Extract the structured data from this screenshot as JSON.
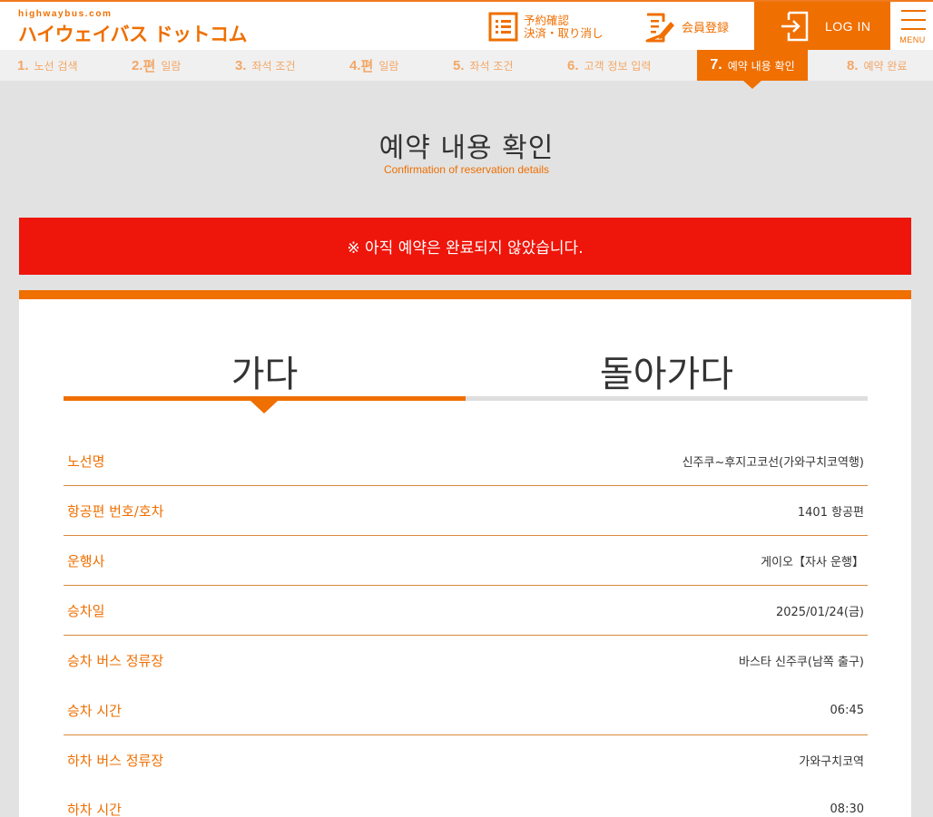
{
  "header": {
    "logo_sub": "highwaybus.com",
    "logo_main": "ハイウェイバス ドットコム",
    "reservation_line1": "予約確認",
    "reservation_line2": "決済・取り消し",
    "register": "会員登録",
    "login": "LOG IN",
    "menu": "MENU"
  },
  "steps": [
    {
      "num": "1.",
      "label": "노선 검색"
    },
    {
      "num": "2.",
      "label": "편",
      "label2": "일람"
    },
    {
      "num": "3.",
      "label": "좌석 조건"
    },
    {
      "num": "4.",
      "label": "편",
      "label2": "일람"
    },
    {
      "num": "5.",
      "label": "좌석 조건"
    },
    {
      "num": "6.",
      "label": "고객 정보 입력"
    },
    {
      "num": "7.",
      "label": "예약 내용 확인"
    },
    {
      "num": "8.",
      "label": "예약 완료"
    }
  ],
  "page": {
    "title": "예약 내용 확인",
    "subtitle": "Confirmation of reservation details",
    "alert": "※ 아직 예약은 완료되지 않았습니다."
  },
  "tabs": {
    "outbound": "가다",
    "return": "돌아가다"
  },
  "details": [
    {
      "label": "노선명",
      "value": "신주쿠~후지고코선(가와구치코역행)"
    },
    {
      "label": "항공편 번호/호차",
      "value": "1401 항공편"
    },
    {
      "label": "운행사",
      "value": "게이오【자사 운행】"
    },
    {
      "label": "승차일",
      "value": "2025/01/24(금)"
    },
    {
      "label": "승차 버스 정류장",
      "value": "바스타 신주쿠(남쪽 출구)"
    },
    {
      "label": "승차 시간",
      "value": "06:45"
    },
    {
      "label": "하차 버스 정류장",
      "value": "가와구치코역"
    },
    {
      "label": "하차 시간",
      "value": "08:30"
    }
  ],
  "colors": {
    "accent": "#ef6f00",
    "alert": "#ee150a"
  }
}
